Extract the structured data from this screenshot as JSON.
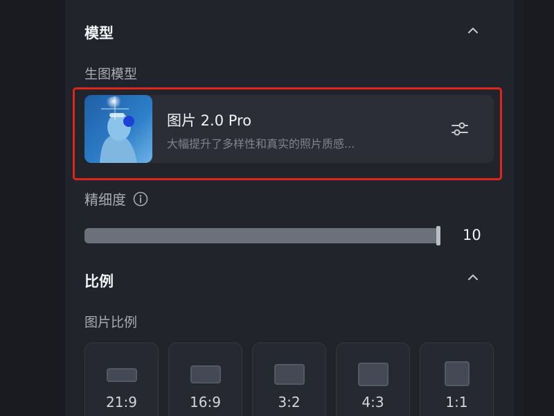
{
  "model_section": {
    "title": "模型",
    "sub_label": "生图模型",
    "card": {
      "name": "图片 2.0 Pro",
      "description": "大幅提升了多样性和真实的照片质感..."
    }
  },
  "precision": {
    "label": "精细度",
    "value_text": "10",
    "level": 1.0
  },
  "ratio_section": {
    "title": "比例",
    "sub_label": "图片比例",
    "options": [
      "21:9",
      "16:9",
      "3:2",
      "4:3",
      "1:1"
    ]
  },
  "colors": {
    "panel_bg": "#22242c",
    "card_bg": "#2c2e37",
    "highlight_border": "#e0261c",
    "slider_track": "#5d646e"
  },
  "icons": {
    "collapse": "chevron-up-icon",
    "settings": "sliders-icon",
    "info": "info-circle-icon"
  }
}
